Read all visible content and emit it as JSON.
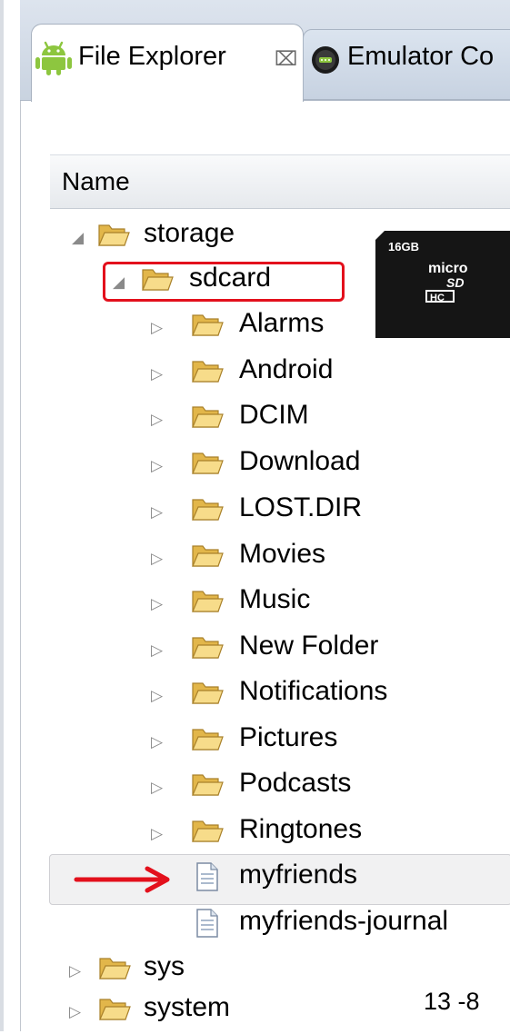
{
  "tabs": [
    {
      "label": "File Explorer",
      "icon": "android-icon",
      "close": "⌧"
    },
    {
      "label": "Emulator Co",
      "icon": "emulator-control-icon"
    }
  ],
  "table": {
    "column_header": "Name"
  },
  "tree": {
    "storage": {
      "label": "storage",
      "expanded": true
    },
    "sdcard": {
      "label": "sdcard",
      "expanded": true
    },
    "sdcard_children": [
      {
        "label": "Alarms",
        "type": "folder"
      },
      {
        "label": "Android",
        "type": "folder"
      },
      {
        "label": "DCIM",
        "type": "folder"
      },
      {
        "label": "Download",
        "type": "folder"
      },
      {
        "label": "LOST.DIR",
        "type": "folder"
      },
      {
        "label": "Movies",
        "type": "folder"
      },
      {
        "label": "Music",
        "type": "folder"
      },
      {
        "label": "New Folder",
        "type": "folder"
      },
      {
        "label": "Notifications",
        "type": "folder"
      },
      {
        "label": "Pictures",
        "type": "folder"
      },
      {
        "label": "Podcasts",
        "type": "folder"
      },
      {
        "label": "Ringtones",
        "type": "folder"
      },
      {
        "label": "myfriends",
        "type": "file",
        "selected": true
      },
      {
        "label": "myfriends-journal",
        "type": "file"
      }
    ],
    "root_siblings": [
      {
        "label": "sys",
        "type": "folder"
      },
      {
        "label": "system",
        "type": "folder"
      }
    ]
  },
  "sdcard_image": {
    "capacity": "16GB",
    "brand": "micro",
    "type": "SD",
    "class": "HC"
  },
  "annotations": {
    "highlight_color": "#e3101c",
    "arrow_color": "#e3101c"
  },
  "page_number": "13 -8"
}
